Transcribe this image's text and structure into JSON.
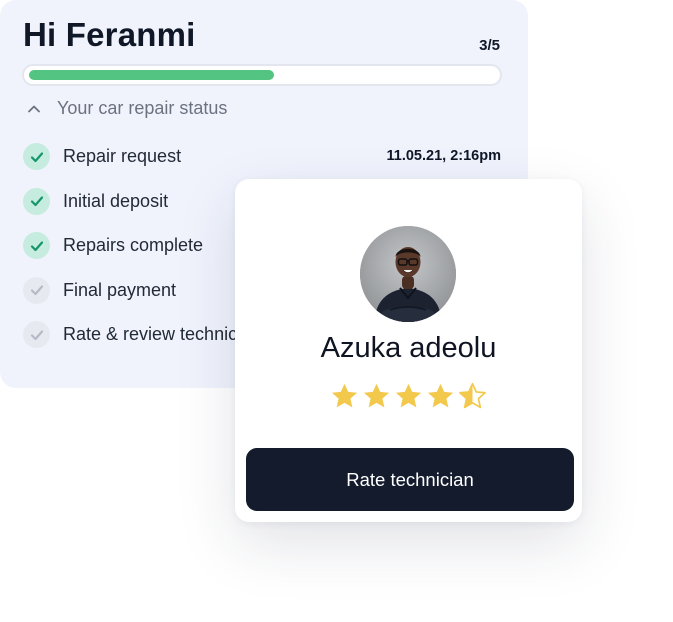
{
  "status_card": {
    "greeting": "Hi Feranmi",
    "step_count": "3/5",
    "progress_fraction": 0.525,
    "section_title": "Your car repair status",
    "steps": [
      {
        "label": "Repair request",
        "timestamp": "11.05.21, 2:16pm",
        "completed": true
      },
      {
        "label": "Initial deposit",
        "completed": true
      },
      {
        "label": "Repairs complete",
        "completed": true
      },
      {
        "label": "Final payment",
        "completed": false
      },
      {
        "label": "Rate & review technician",
        "completed": false
      }
    ]
  },
  "technician_card": {
    "name": "Azuka adeolu",
    "rating": 4.5,
    "rating_max": 5,
    "button_label": "Rate technician"
  },
  "colors": {
    "accent_green": "#53c482",
    "check_done_bg": "#c5ecde",
    "check_done_mark": "#17956a",
    "check_pending_bg": "#e6e9ef",
    "check_pending_mark": "#b5bac6",
    "star_gold": "#f2c94c",
    "button_dark": "#131b2c",
    "card_bg": "#f0f3fc"
  },
  "icons": {
    "collapse": "chevron-up-icon",
    "step_status": "check-icon",
    "rating": "star-icon"
  }
}
